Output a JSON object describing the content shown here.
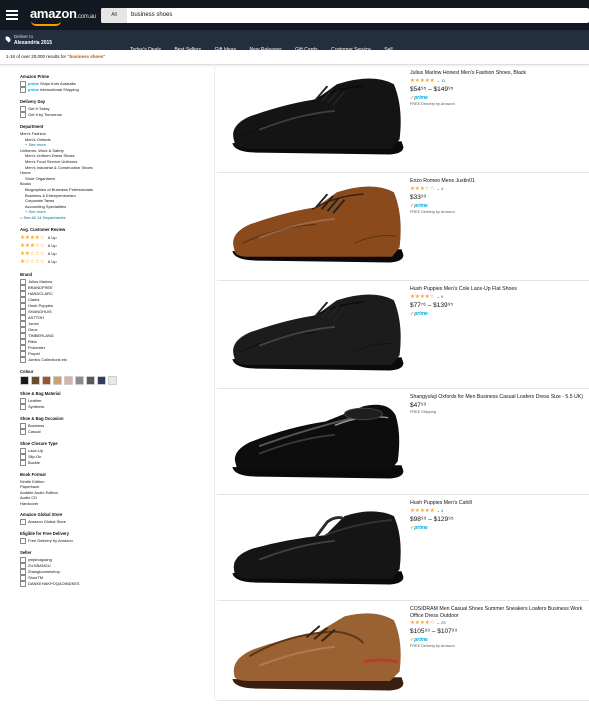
{
  "header": {
    "logo_text": "amazon",
    "logo_suffix": ".com.au",
    "search_category": "All",
    "search_query": "business shoes",
    "deliver_line1": "Deliver to",
    "deliver_line2": "Alexandria 2015"
  },
  "nav": {
    "links": [
      "Today's Deals",
      "Best Sellers",
      "Gift Ideas",
      "New Releases",
      "Gift Cards",
      "Customer Service",
      "Sell"
    ]
  },
  "results": {
    "count_text": "1-16 of over 20,000 results for",
    "query_text": "\"business shoes\""
  },
  "sidebar": {
    "amazon_prime": {
      "heading": "Amazon Prime",
      "items": [
        "Ships from Australia",
        "International Shipping"
      ]
    },
    "delivery_day": {
      "heading": "Delivery Day",
      "items": [
        "Get It Today",
        "Get It by Tomorrow"
      ]
    },
    "department": {
      "heading": "Department",
      "items": [
        {
          "label": "Men's Fashion",
          "level": 0
        },
        {
          "label": "Men's Oxfords",
          "level": 1
        },
        {
          "label": "+ See more",
          "level": 1,
          "link": true
        },
        {
          "label": "Uniforms, Work & Safety",
          "level": 0
        },
        {
          "label": "Men's Uniform Dress Shoes",
          "level": 1
        },
        {
          "label": "Men's Food Service Uniforms",
          "level": 1
        },
        {
          "label": "Men's Industrial & Construction Shoes",
          "level": 1
        },
        {
          "label": "Home",
          "level": 0
        },
        {
          "label": "Shoe Organisers",
          "level": 1
        },
        {
          "label": "Books",
          "level": 0
        },
        {
          "label": "Biographies of Business Professionals",
          "level": 1
        },
        {
          "label": "Business & Entrepreneurism",
          "level": 1
        },
        {
          "label": "Corporate Taxes",
          "level": 1
        },
        {
          "label": "Accounting Specialities",
          "level": 1
        },
        {
          "label": "+ See more",
          "level": 1,
          "link": true
        },
        {
          "label": "< See All 14 Departments",
          "level": 0,
          "link": true
        }
      ]
    },
    "customer_review": {
      "heading": "Avg. Customer Review",
      "rows": [
        4,
        3,
        2,
        1
      ],
      "suffix": "& Up"
    },
    "brand": {
      "heading": "Brand",
      "items": [
        "Julius Marlow",
        "BRANDFREE",
        "HANDCLARC",
        "Clarks",
        "Hush Puppies",
        "SHANGHUIS",
        "ASTTOH",
        "Jones",
        "Geox",
        "TIMBERLAND",
        "Rikio",
        "Prokester",
        "Propet",
        "Jumbo Collections etc"
      ]
    },
    "colour": {
      "heading": "Colour",
      "swatches": [
        "#1a1a1a",
        "#6b4a2e",
        "#a0522d",
        "#c9a27a",
        "#d8b4a0",
        "#8c8c8c",
        "#5a5a5a",
        "#2f3e5c",
        "#e8e8e8"
      ]
    },
    "shoe_material": {
      "heading": "Shoe & Bag Material",
      "items": [
        "Leather",
        "Synthetic"
      ]
    },
    "shoe_occasion": {
      "heading": "Shoe & Bag Occasion",
      "items": [
        "Business",
        "Casual"
      ]
    },
    "shoe_closure": {
      "heading": "Shoe Closure Type",
      "items": [
        "Lace-Up",
        "Slip-On",
        "Buckle"
      ]
    },
    "book_format": {
      "heading": "Book Format",
      "items": [
        "Kindle Edition",
        "Paperback",
        "Audible Audio Edition",
        "Audio CD",
        "Hardcover"
      ]
    },
    "global_store": {
      "heading": "Amazon Global Store",
      "items": [
        "Amazon Global Store"
      ]
    },
    "free_delivery": {
      "heading": "Eligible for Free Delivery",
      "items": [
        "Free Delivery by Amazon"
      ]
    },
    "seller": {
      "heading": "Seller",
      "items": [
        "ymjshoguang",
        "ZUJIBANGU",
        "Zhangluomeishop",
        "ShoeTM",
        "DANKEHAKPOQAOINDKES"
      ]
    }
  },
  "products": [
    {
      "title": "Julius Marlow Honest Men's Fashion Shoes, Black",
      "rating": 5,
      "reviews": "11",
      "price": "$54⁹⁵ – $149⁹⁵",
      "prime": "prime",
      "shipping": "FREE Delivery by Amazon",
      "shoe_color": "#141414",
      "shoe_style": "oxford-lace"
    },
    {
      "title": "Enzo Romeo Mens Justin01",
      "rating": 3,
      "reviews": "4",
      "price": "$33⁹⁹",
      "prime": "prime",
      "shipping": "FREE Delivery by Amazon",
      "shoe_color": "#8a4a1c",
      "shoe_style": "derby-lace"
    },
    {
      "title": "Hush Puppies Men's Cole Lace-Up Flat Shoes",
      "rating": 4,
      "reviews": "6",
      "price": "$77⁷⁶ – $139⁹⁵",
      "prime": "prime",
      "shipping": "",
      "shoe_color": "#1c1c1c",
      "shoe_style": "derby-lace"
    },
    {
      "title": "Shangyuluji Oxfords for Men Business Casual Loafers Dress Size - 5.5 UK)",
      "rating": 0,
      "reviews": "",
      "price": "$47⁹⁹",
      "prime": "",
      "shipping": "FREE Shipping",
      "shoe_color": "#0d0d0d",
      "shoe_style": "loafer-patent"
    },
    {
      "title": "Hush Puppies Men's Cahill",
      "rating": 5,
      "reviews": "4",
      "price": "$98⁹⁹ – $129⁹⁵",
      "prime": "prime",
      "shipping": "",
      "shoe_color": "#151515",
      "shoe_style": "slip-on"
    },
    {
      "title": "COSIDRAM Men Casual Shoes Summer Sneakers Loafers Business Work Office Dress Outdoor",
      "rating": 4,
      "reviews": "25",
      "price": "$105⁹⁹ – $107⁹⁹",
      "prime": "prime",
      "shipping": "FREE Delivery by Amazon",
      "shoe_color": "#9a6232",
      "shoe_style": "casual-moc"
    }
  ]
}
